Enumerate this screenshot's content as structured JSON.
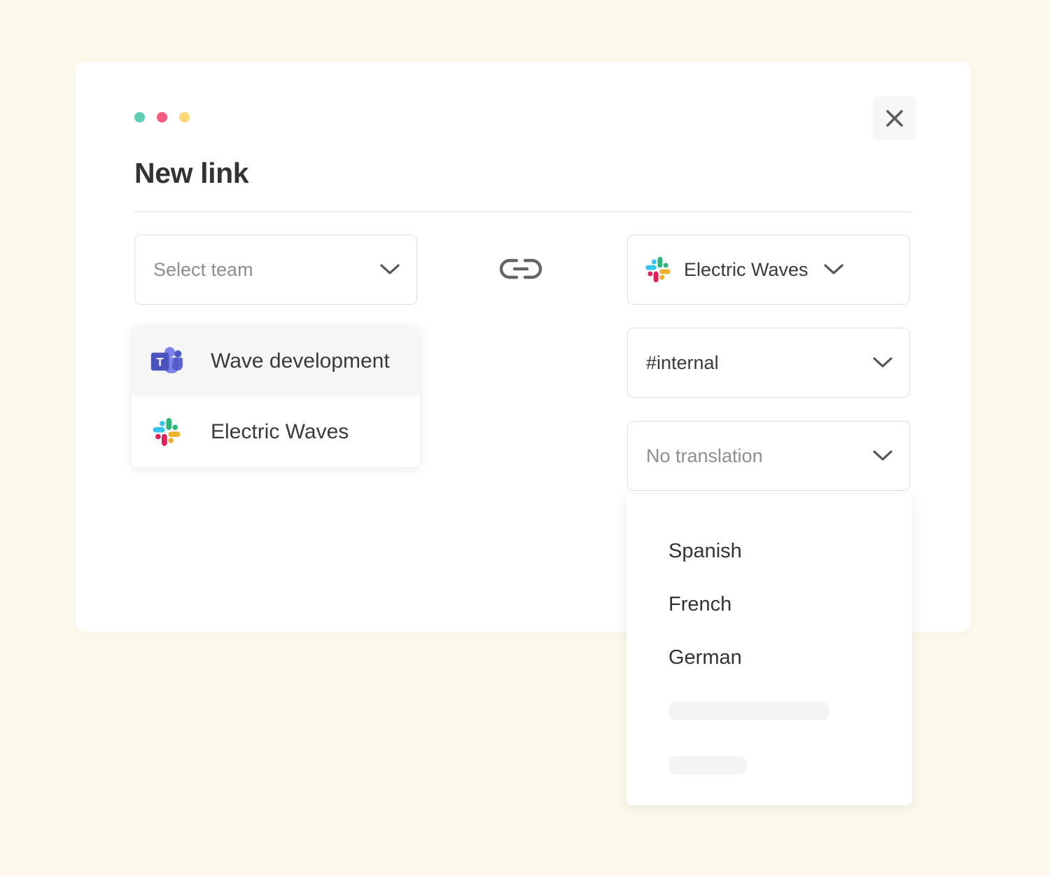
{
  "window": {
    "dots": [
      {
        "name": "traffic-light-green",
        "color": "#5ecfb4"
      },
      {
        "name": "traffic-light-red",
        "color": "#f85d7f"
      },
      {
        "name": "traffic-light-yellow",
        "color": "#f9d777"
      }
    ],
    "close_label": "Close"
  },
  "background_color": "#fdfaed",
  "modal": {
    "title": "New link",
    "left_column": {
      "team_select": {
        "placeholder": "Select team",
        "value": "",
        "chevron_icon": "chevron-down-icon"
      },
      "team_dropdown": {
        "options": [
          {
            "label": "Wave development",
            "icon": "microsoft-teams-icon",
            "highlighted": true
          },
          {
            "label": "Electric Waves",
            "icon": "slack-icon",
            "highlighted": false
          }
        ]
      }
    },
    "link_icon": "link-icon",
    "right_column": {
      "workspace_select": {
        "value": "Electric Waves",
        "icon": "slack-icon",
        "chevron_icon": "chevron-down-icon"
      },
      "channel_select": {
        "value": "#internal",
        "chevron_icon": "chevron-down-icon"
      },
      "translation_select": {
        "placeholder": "No translation",
        "chevron_icon": "chevron-down-icon"
      },
      "translation_dropdown": {
        "options": [
          "Spanish",
          "French",
          "German"
        ],
        "loading_placeholders": 2
      }
    }
  }
}
